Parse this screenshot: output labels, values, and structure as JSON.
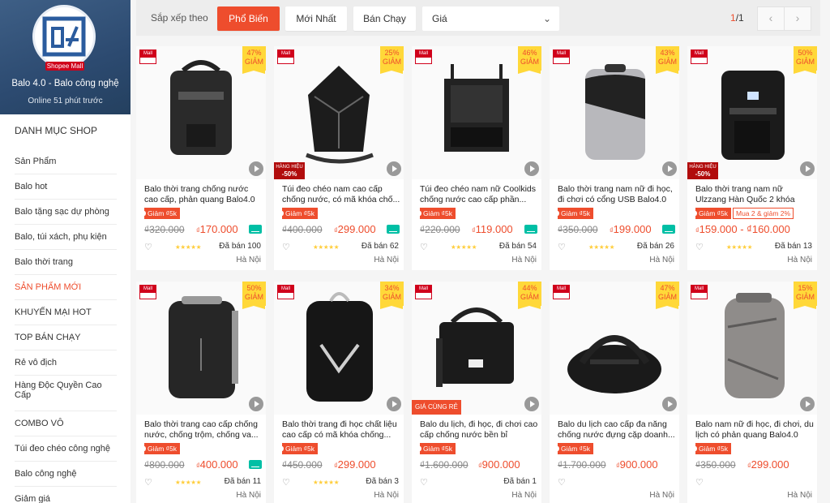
{
  "shop": {
    "logo_text": "4",
    "mall_label": "Shopee Mall",
    "name": "Balo 4.0 - Balo công nghệ",
    "online": "Online 51 phút trước"
  },
  "categories": {
    "heading": "DANH MỤC SHOP",
    "items": [
      "Sản Phẩm",
      "Balo hot",
      "Balo tặng sạc dự phòng",
      "Balo, túi xách, phụ kiện",
      "Balo thời trang",
      "SẢN PHẨM MỚI",
      "KHUYẾN MẠI HOT",
      "TOP BÁN CHẠY",
      "Rẻ vô địch",
      "Hàng Độc Quyền Cao Cấp",
      "COMBO VÔ",
      "Túi đeo chéo công nghệ",
      "Balo công nghệ",
      "Giảm giá"
    ]
  },
  "sort": {
    "label": "Sắp xếp theo",
    "popular": "Phổ Biến",
    "newest": "Mới Nhất",
    "best": "Bán Chạy",
    "price": "Giá",
    "page_current": "1",
    "page_total": "/1"
  },
  "labels": {
    "mall": "Mall",
    "giam": "GIẢM",
    "voucher": "Giảm ₫5k",
    "hang_hieu": "HÀNG HIỆU",
    "gia_tot": "GIÁ CÙNG RẺ",
    "currency": "₫",
    "stars": "★★★★★"
  },
  "colors": {
    "accent": "#ee4d2d",
    "discount_bg": "#ffd839",
    "banner": "#3e5f86"
  },
  "products": [
    {
      "title": "Balo thời trang chống nước cao cấp, phản quang Balo4.0",
      "discount": "47%",
      "old": "₫320.000",
      "price": "170.000",
      "sold": "Đã bán 100",
      "loc": "Hà Nội",
      "stars": true,
      "ship": true,
      "brand": false,
      "combo": ""
    },
    {
      "title": "Túi đeo chéo nam cao cấp chống nước, có mã khóa chố...",
      "discount": "25%",
      "old": "₫400.000",
      "price": "299.000",
      "sold": "Đã bán 62",
      "loc": "Hà Nội",
      "stars": true,
      "ship": true,
      "brand": true,
      "brand_pct": "-50%",
      "combo": ""
    },
    {
      "title": "Túi đeo chéo nam nữ Coolkids chống nước cao cấp phần...",
      "discount": "46%",
      "old": "₫220.000",
      "price": "119.000",
      "sold": "Đã bán 54",
      "loc": "Hà Nội",
      "stars": true,
      "ship": true,
      "brand": false,
      "combo": ""
    },
    {
      "title": "Balo thời trang nam nữ đi học, đi chơi có cổng USB Balo4.0",
      "discount": "43%",
      "old": "₫350.000",
      "price": "199.000",
      "sold": "Đã bán 26",
      "loc": "Hà Nội",
      "stars": true,
      "ship": true,
      "brand": false,
      "combo": ""
    },
    {
      "title": "Balo thời trang nam nữ Ulzzang Hàn Quốc 2 khóa song song...",
      "discount": "50%",
      "old": "",
      "price": "159.000 - ₫160.000",
      "sold": "Đã bán 13",
      "loc": "Hà Nội",
      "stars": true,
      "ship": false,
      "brand": true,
      "brand_pct": "-50%",
      "combo": "Mua 2 & giảm 2%"
    },
    {
      "title": "Balo thời trang cao cấp chống nước, chống trộm, chống va...",
      "discount": "50%",
      "old": "₫800.000",
      "price": "400.000",
      "sold": "Đã bán 11",
      "loc": "Hà Nội",
      "stars": true,
      "ship": true,
      "brand": false,
      "combo": ""
    },
    {
      "title": "Balo thời trang đi học chất liệu cao cấp có mã khóa chống...",
      "discount": "34%",
      "old": "₫450.000",
      "price": "299.000",
      "sold": "Đã bán 3",
      "loc": "Hà Nội",
      "stars": true,
      "ship": false,
      "brand": false,
      "combo": ""
    },
    {
      "title": "Balo du lịch, đi học, đi chơi cao cấp chống nước bền bỉ Balo4.0",
      "discount": "44%",
      "old": "₫1.600.000",
      "price": "900.000",
      "sold": "Đã bán 1",
      "loc": "Hà Nội",
      "stars": false,
      "ship": false,
      "brand": false,
      "combo": "",
      "gia_tot": true
    },
    {
      "title": "Balo du lịch cao cấp đa năng chống nước đựng cặp doanh...",
      "discount": "47%",
      "old": "₫1.700.000",
      "price": "900.000",
      "sold": "",
      "loc": "Hà Nội",
      "stars": false,
      "ship": false,
      "brand": false,
      "combo": ""
    },
    {
      "title": "Balo nam nữ đi học, đi chơi, du lịch có phản quang Balo4.0",
      "discount": "15%",
      "old": "₫350.000",
      "price": "299.000",
      "sold": "",
      "loc": "Hà Nội",
      "stars": false,
      "ship": false,
      "brand": false,
      "combo": ""
    }
  ]
}
